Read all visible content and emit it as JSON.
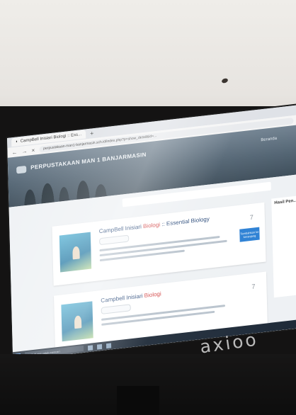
{
  "browser": {
    "tab_title": "CampBell Inisiari Biologi :: Ess...",
    "tab_add": "+",
    "back": "←",
    "forward": "→",
    "close": "×",
    "url": "perpustakaan-man1-banjarmasin.sch.id/index.php?p=show_detail&id=..."
  },
  "site": {
    "title": "PERPUSTAKAAN MAN 1 BANJARMASIN",
    "menu_label": "Beranda"
  },
  "results": [
    {
      "title_prefix": "CampBell Inisiari ",
      "title_highlight": "Biologi",
      "title_suffix": " :: Essential Biology",
      "count": "7",
      "button": "Tambahkan ke keranjang"
    },
    {
      "title_prefix": "Campbell Inisiari ",
      "title_highlight": "Biologi",
      "title_suffix": "",
      "count": "7"
    }
  ],
  "sidebar": {
    "title": "Hasil Pen..."
  },
  "taskbar": {
    "search_placeholder": "Ketik di sini untuk mencari"
  },
  "brand": "axioo",
  "colors": {
    "accent": "#2a7fd4",
    "header": "#4f6170",
    "monitor": "#141313"
  }
}
